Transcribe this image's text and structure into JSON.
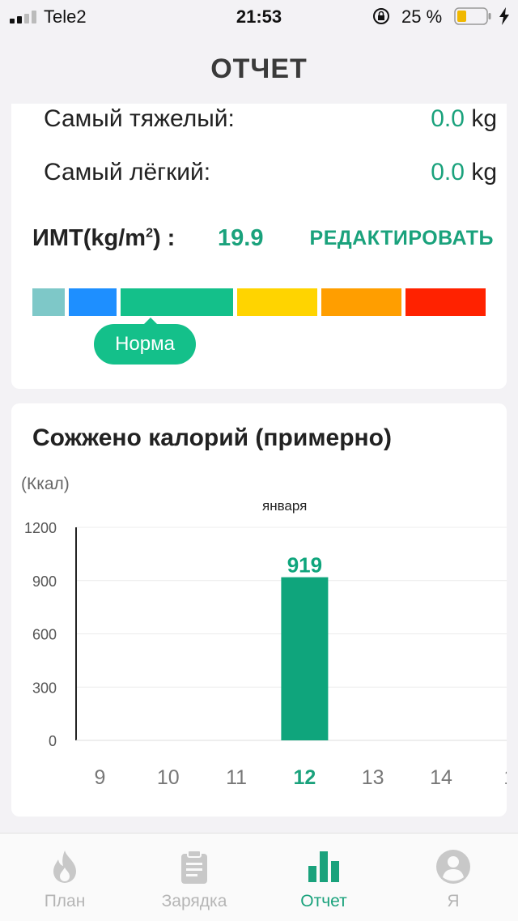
{
  "status_bar": {
    "carrier": "Tele2",
    "time": "21:53",
    "battery": "25 %"
  },
  "header": {
    "title": "ОТЧЕТ"
  },
  "weight_stats": {
    "heaviest_label": "Самый тяжелый:",
    "heaviest_value": "0.0",
    "heaviest_unit": "kg",
    "lightest_label": "Самый лёгкий:",
    "lightest_value": "0.0",
    "lightest_unit": "kg"
  },
  "bmi": {
    "label_main": "ИМТ(kg/m",
    "label_sup": "2",
    "label_tail": ") :",
    "value": "19.9",
    "edit_label": "РЕДАКТИРОВАТЬ",
    "status": "Норма",
    "segment_colors": [
      "#7ec8c8",
      "#1e8fff",
      "#14c08a",
      "#ffd400",
      "#ff9e00",
      "#ff2200"
    ]
  },
  "calories": {
    "title": "Сожжено калорий (примерно)",
    "unit": "(Ккал)",
    "month": "января"
  },
  "chart_data": {
    "type": "bar",
    "categories": [
      "9",
      "10",
      "11",
      "12",
      "13",
      "14",
      "1"
    ],
    "values": [
      0,
      0,
      0,
      919,
      0,
      0,
      0
    ],
    "highlight_category": "12",
    "bar_labels": [
      "",
      "",
      "",
      "919",
      "",
      "",
      ""
    ],
    "yticks": [
      "0",
      "300",
      "600",
      "900",
      "1200"
    ],
    "ylim": [
      0,
      1200
    ],
    "xlabel": "января",
    "ylabel": "(Ккал)",
    "grid": true,
    "bar_color": "#0fa57c"
  },
  "tabs": [
    {
      "label": "План",
      "icon": "flame-icon",
      "active": false
    },
    {
      "label": "Зарядка",
      "icon": "clipboard-icon",
      "active": false
    },
    {
      "label": "Отчет",
      "icon": "bar-chart-icon",
      "active": true
    },
    {
      "label": "Я",
      "icon": "user-icon",
      "active": false
    }
  ]
}
